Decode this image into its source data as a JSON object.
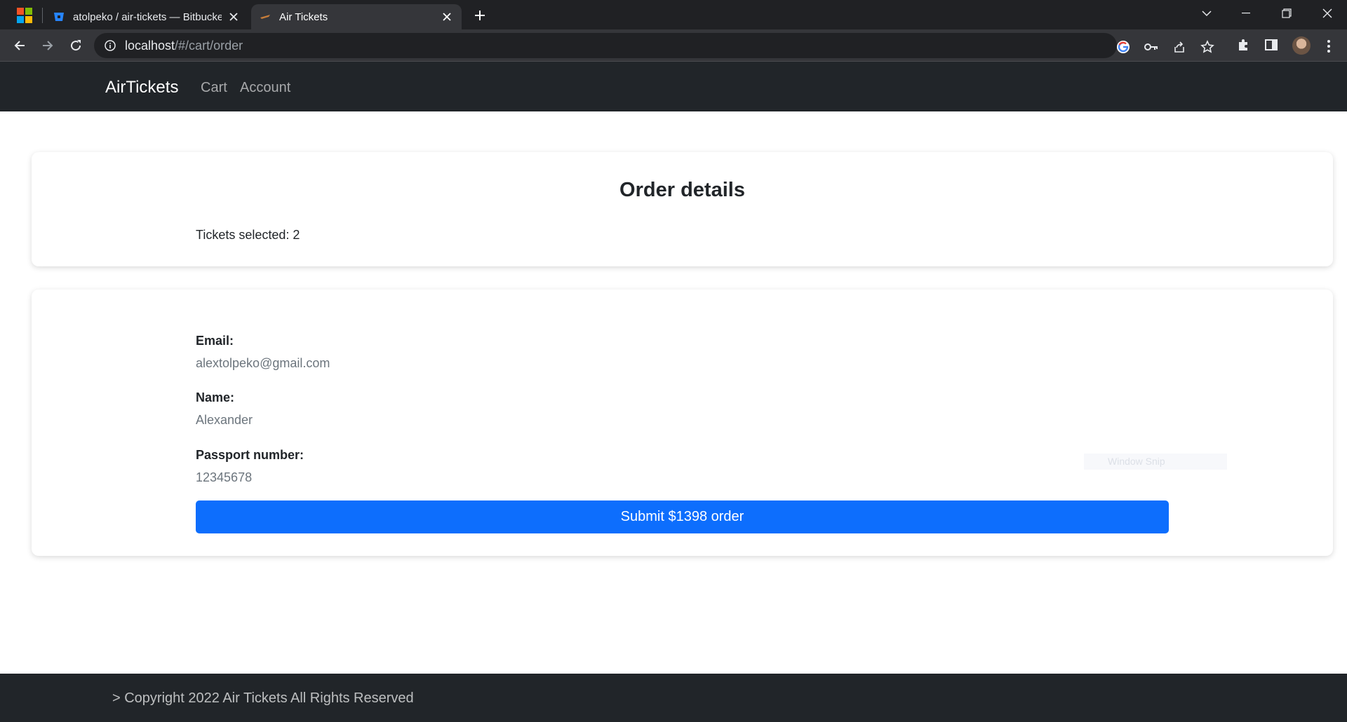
{
  "browser": {
    "tabs": [
      {
        "title": "atolpeko / air-tickets — Bitbucket",
        "active": false
      },
      {
        "title": "Air Tickets",
        "active": true
      }
    ],
    "url_host": "localhost",
    "url_path": "/#/cart/order"
  },
  "site": {
    "brand": "AirTickets",
    "nav": [
      "Cart",
      "Account"
    ]
  },
  "order": {
    "heading": "Order details",
    "tickets_selected": "Tickets selected: 2"
  },
  "form": {
    "email_label": "Email:",
    "email_value": "alextolpeko@gmail.com",
    "name_label": "Name:",
    "name_value": "Alexander",
    "passport_label": "Passport number:",
    "passport_value": "12345678",
    "submit_label": "Submit $1398 order"
  },
  "overlay": {
    "ghost_text": "Window Snip"
  },
  "footer": {
    "copyright": "> Copyright 2022 Air Tickets All Rights Reserved"
  },
  "colors": {
    "primary": "#0d6efd",
    "navbar": "#212529",
    "chrome_dark": "#202124"
  }
}
